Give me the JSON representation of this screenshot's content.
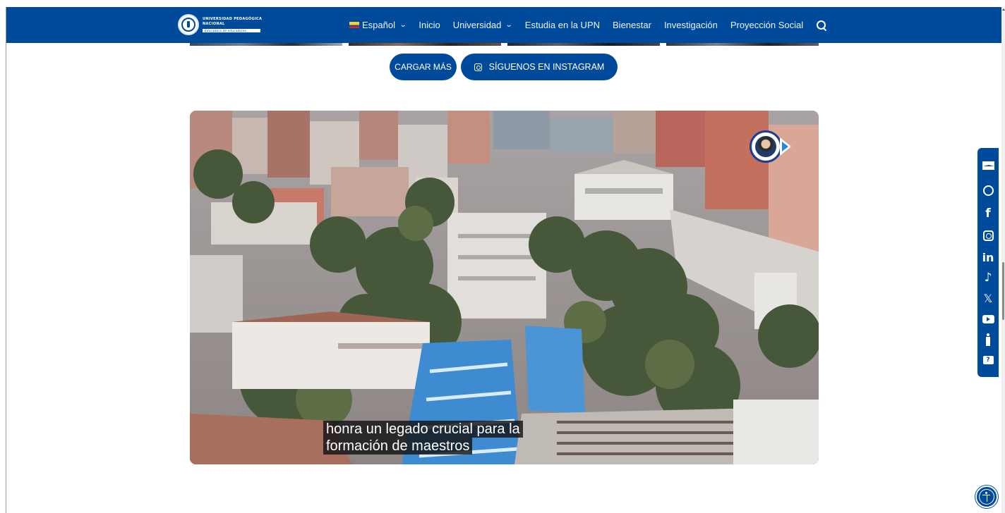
{
  "header": {
    "logo": {
      "name_line1": "UNIVERSIDAD PEDAGÓGICA",
      "name_line2": "NACIONAL",
      "tagline": "Educadora de educadores"
    },
    "nav": [
      {
        "label": "Español",
        "has_dropdown": true,
        "icon": "colombia-flag-icon"
      },
      {
        "label": "Inicio",
        "has_dropdown": false
      },
      {
        "label": "Universidad",
        "has_dropdown": true
      },
      {
        "label": "Estudia en la UPN",
        "has_dropdown": false
      },
      {
        "label": "Bienestar",
        "has_dropdown": false
      },
      {
        "label": "Investigación",
        "has_dropdown": false
      },
      {
        "label": "Proyección Social",
        "has_dropdown": false
      }
    ],
    "search_icon": "search-icon",
    "chevron": "⌄"
  },
  "instagram": {
    "load_more_label": "CARGAR MÁS",
    "follow_label": "SÍGUENOS EN INSTAGRAM"
  },
  "video": {
    "caption_line1": "honra un legado crucial para la",
    "caption_line2": "formación de maestros"
  },
  "social_sidebar": [
    "email-icon",
    "whatsapp-icon",
    "facebook-icon",
    "instagram-icon",
    "linkedin-icon",
    "tiktok-icon",
    "x-icon",
    "youtube-icon",
    "accessibility-person-icon",
    "help-chat-icon"
  ],
  "social_glyphs": {
    "facebook": "f",
    "linkedin": "in",
    "tiktok": "♪",
    "x": "𝕏",
    "help": "?"
  },
  "colors": {
    "brand_blue": "#004a9c",
    "background": "#ffffff"
  }
}
